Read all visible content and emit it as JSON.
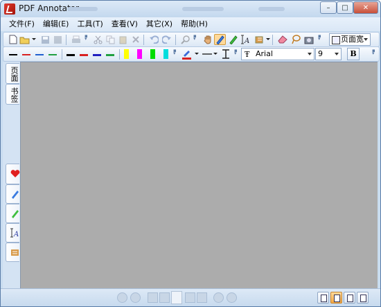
{
  "window": {
    "title": "PDF Annotator"
  },
  "caption": {
    "minimize": "–",
    "maximize": "□",
    "close": "✕"
  },
  "menu": [
    {
      "label": "文件(F)"
    },
    {
      "label": "编辑(E)"
    },
    {
      "label": "工具(T)"
    },
    {
      "label": "查看(V)"
    },
    {
      "label": "其它(X)"
    },
    {
      "label": "帮助(H)"
    }
  ],
  "toolbar1": {
    "zoom_value": "页面宽",
    "icons": [
      "new-document-icon",
      "open-folder-icon",
      "save-icon",
      "save-all-icon",
      "print-icon",
      "cut-icon",
      "copy-icon",
      "paste-icon",
      "delete-icon",
      "undo-icon",
      "redo-icon",
      "search-icon",
      "hand-tool-icon",
      "pen-tool-icon",
      "highlighter-tool-icon",
      "text-tool-icon",
      "stamp-tool-icon",
      "eraser-icon",
      "lasso-icon",
      "snapshot-icon",
      "zoom-page-icon"
    ]
  },
  "toolbar2": {
    "pen_colors": [
      "#c00000",
      "#e03030",
      "#2060d0",
      "#20a040",
      "#000000",
      "#c00000",
      "#2020c0",
      "#20a040"
    ],
    "highlight_colors": [
      "#ffff00",
      "#ff00ff",
      "#00dd00",
      "#00dddd"
    ],
    "font_name": "Arial",
    "font_size": "9",
    "bold_label": "B"
  },
  "side_tabs": [
    {
      "label": "页面"
    },
    {
      "label": "书签"
    }
  ],
  "side_tools": [
    "favorites-heart-icon",
    "blue-pen-icon",
    "green-highlighter-icon",
    "text-annotation-icon",
    "stamp-icon"
  ],
  "colors": {
    "document_background": "#acacac",
    "chrome": "#c9ddf0"
  }
}
